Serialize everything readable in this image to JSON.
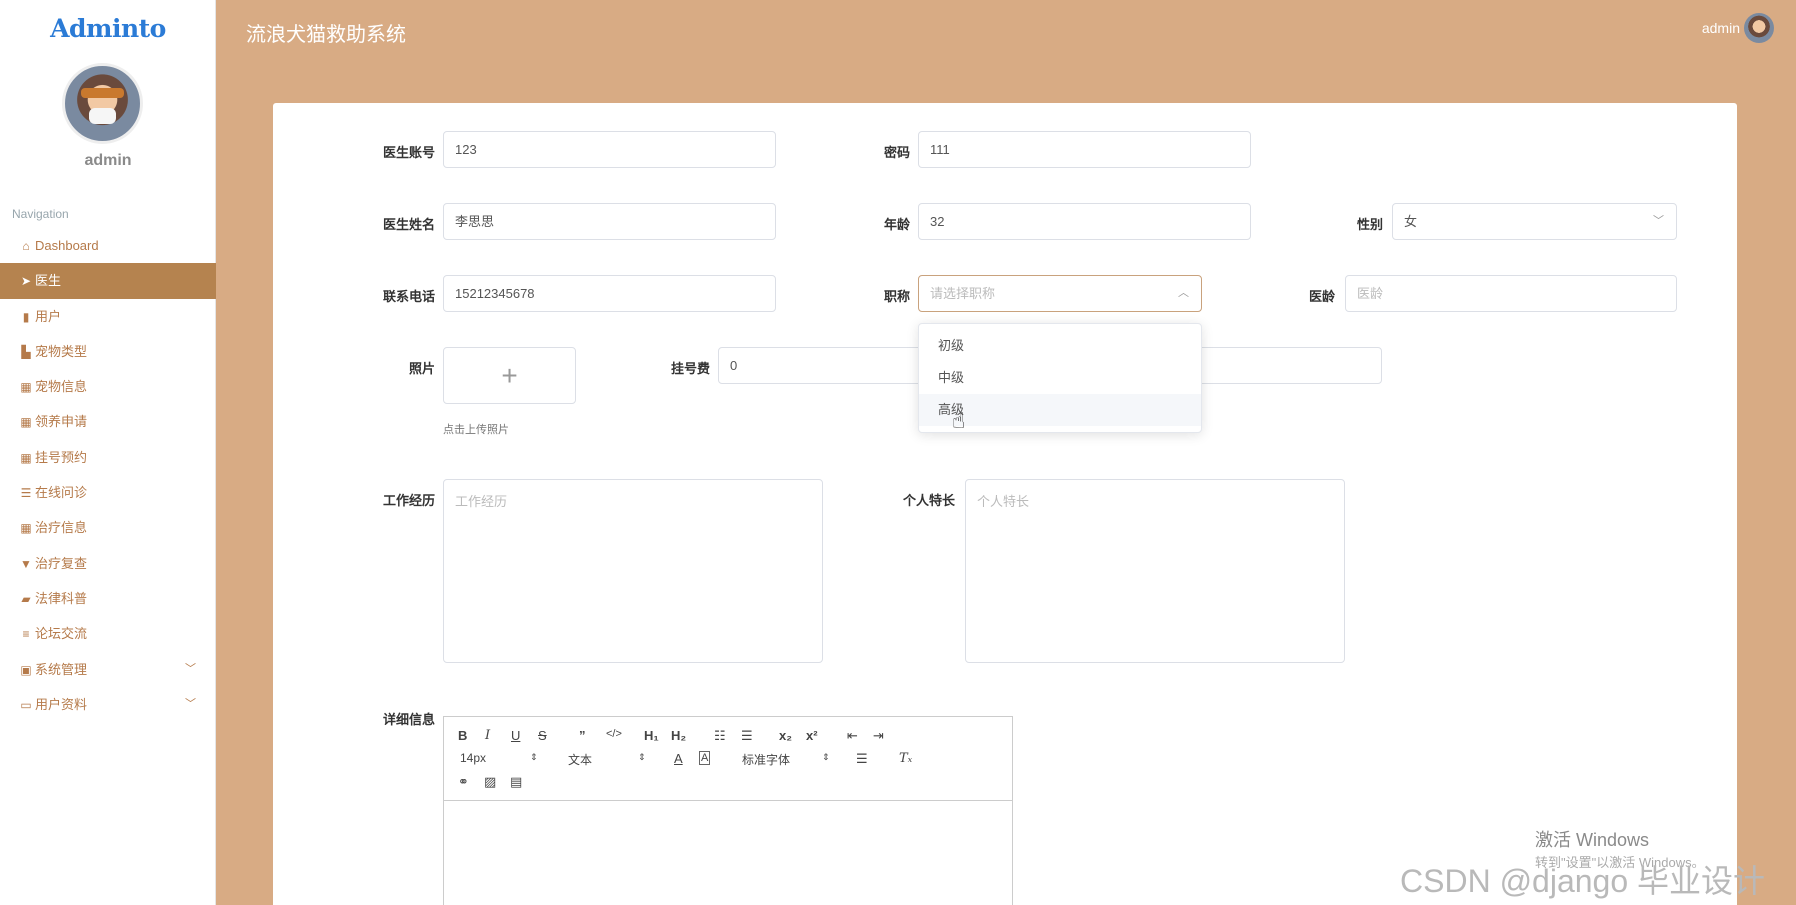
{
  "app": {
    "logo": "Adminto",
    "title": "流浪犬猫救助系统",
    "user": "admin"
  },
  "sidebar": {
    "username": "admin",
    "nav_title": "Navigation",
    "items": [
      {
        "label": "Dashboard",
        "icon": "home-icon"
      },
      {
        "label": "医生",
        "icon": "send-icon"
      },
      {
        "label": "用户",
        "icon": "bar-chart-icon"
      },
      {
        "label": "宠物类型",
        "icon": "book-icon"
      },
      {
        "label": "宠物信息",
        "icon": "grid-icon"
      },
      {
        "label": "领养申请",
        "icon": "grid-icon"
      },
      {
        "label": "挂号预约",
        "icon": "grid-icon"
      },
      {
        "label": "在线问诊",
        "icon": "sliders-icon"
      },
      {
        "label": "治疗信息",
        "icon": "grid-icon"
      },
      {
        "label": "治疗复查",
        "icon": "stamp-icon"
      },
      {
        "label": "法律科普",
        "icon": "ticket-icon"
      },
      {
        "label": "论坛交流",
        "icon": "list-icon"
      },
      {
        "label": "系统管理",
        "icon": "clipboard-icon"
      },
      {
        "label": "用户资料",
        "icon": "card-icon"
      }
    ]
  },
  "form": {
    "account_label": "医生账号",
    "account_value": "123",
    "password_label": "密码",
    "password_value": "111",
    "name_label": "医生姓名",
    "name_value": "李思思",
    "age_label": "年龄",
    "age_value": "32",
    "gender_label": "性别",
    "gender_value": "女",
    "phone_label": "联系电话",
    "phone_value": "15212345678",
    "title_label": "职称",
    "title_placeholder": "请选择职称",
    "seniority_label": "医龄",
    "seniority_placeholder": "医龄",
    "photo_label": "照片",
    "photo_hint": "点击上传照片",
    "upload_plus": "+",
    "fee_label": "挂号费",
    "fee_value": "0",
    "experience_label": "工作经历",
    "experience_placeholder": "工作经历",
    "specialty_label": "个人特长",
    "specialty_placeholder": "个人特长",
    "detail_label": "详细信息"
  },
  "dropdown": {
    "options": [
      "初级",
      "中级",
      "高级"
    ],
    "hovered": "高级"
  },
  "editor": {
    "font_size": "14px",
    "block_type": "文本",
    "font_family": "标准字体"
  },
  "watermark": {
    "activate_title": "激活 Windows",
    "activate_sub": "转到\"设置\"以激活 Windows。",
    "csdn": "CSDN @django 毕业设计"
  },
  "colors": {
    "header_bg": "#d8ab84",
    "active_nav": "#b5834f",
    "nav_text": "#b57a4a"
  }
}
